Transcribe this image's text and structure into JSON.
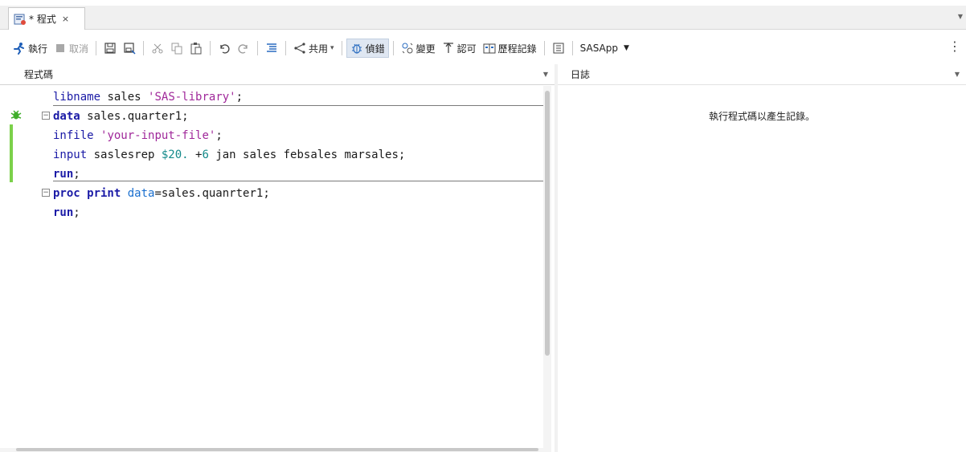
{
  "tab": {
    "title": "* 程式",
    "close": "×",
    "icon": "program-file-icon"
  },
  "toolbar": {
    "run": "執行",
    "cancel": "取消",
    "share": "共用",
    "debug": "偵錯",
    "changes": "變更",
    "approve": "認可",
    "history": "歷程記錄",
    "server": "SASApp",
    "server_arrow": "▼",
    "share_arrow": "▾"
  },
  "panes": {
    "code_title": "程式碼",
    "log_title": "日誌",
    "log_placeholder": "執行程式碼以產生記錄。"
  },
  "code_lines": [
    [
      {
        "t": "libname",
        "c": "fn"
      },
      {
        "t": " sales ",
        "c": "plain"
      },
      {
        "t": "'SAS-library'",
        "c": "str"
      },
      {
        "t": ";",
        "c": "plain"
      }
    ],
    [
      {
        "t": "data",
        "c": "kw"
      },
      {
        "t": " sales.quarter1;",
        "c": "plain"
      }
    ],
    [
      {
        "t": "infile",
        "c": "fn"
      },
      {
        "t": " ",
        "c": "plain"
      },
      {
        "t": "'your-input-file'",
        "c": "str"
      },
      {
        "t": ";",
        "c": "plain"
      }
    ],
    [
      {
        "t": "input",
        "c": "fn"
      },
      {
        "t": " saslesrep ",
        "c": "plain"
      },
      {
        "t": "$20.",
        "c": "num"
      },
      {
        "t": " +",
        "c": "plain"
      },
      {
        "t": "6",
        "c": "num"
      },
      {
        "t": " jan sales febsales marsales;",
        "c": "plain"
      }
    ],
    [
      {
        "t": "run",
        "c": "kw"
      },
      {
        "t": ";",
        "c": "plain"
      }
    ],
    [
      {
        "t": "proc print",
        "c": "kw"
      },
      {
        "t": " ",
        "c": "plain"
      },
      {
        "t": "data",
        "c": "opt"
      },
      {
        "t": "=sales.quanrter1;",
        "c": "plain"
      }
    ],
    [
      {
        "t": "run",
        "c": "kw"
      },
      {
        "t": ";",
        "c": "plain"
      }
    ]
  ],
  "fold_marks": [
    "",
    "⊟",
    "",
    "",
    "",
    "⊟",
    ""
  ],
  "colors": {
    "accent_green": "#7bd14a",
    "keyword": "#1a1aa6",
    "string": "#a0289a",
    "number": "#148a8a"
  }
}
